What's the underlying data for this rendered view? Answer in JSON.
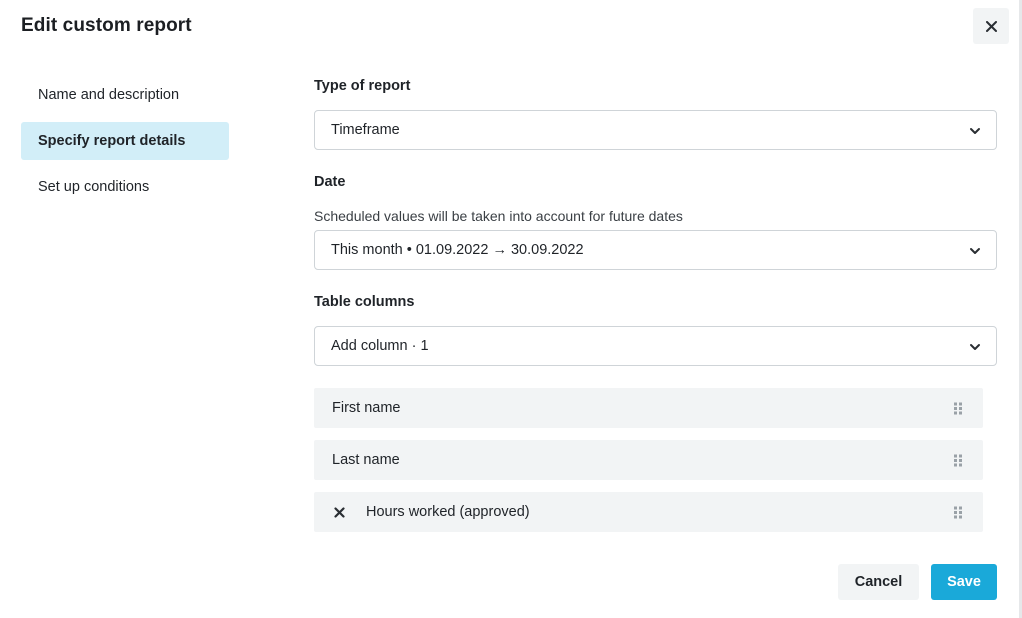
{
  "dialog": {
    "title": "Edit custom report"
  },
  "nav": {
    "items": [
      {
        "label": "Name and description",
        "active": false
      },
      {
        "label": "Specify report details",
        "active": true
      },
      {
        "label": "Set up conditions",
        "active": false
      }
    ]
  },
  "form": {
    "report_type": {
      "label": "Type of report",
      "value": "Timeframe"
    },
    "date": {
      "label": "Date",
      "helper": "Scheduled values will be taken into account for future dates",
      "value": "This month • 01.09.2022 → 30.09.2022"
    },
    "table_columns": {
      "label": "Table columns",
      "add_value": "Add column · 1",
      "columns": [
        {
          "label": "First name",
          "removable": false
        },
        {
          "label": "Last name",
          "removable": false
        },
        {
          "label": "Hours worked (approved)",
          "removable": true
        }
      ]
    }
  },
  "footer": {
    "cancel_label": "Cancel",
    "save_label": "Save"
  },
  "colors": {
    "accent": "#1aa9d9",
    "active_nav_bg": "#d2eef8",
    "row_bg": "#f2f4f5"
  },
  "icons": {
    "close": "close-icon",
    "chevron": "chevron-down-icon",
    "drag": "drag-handle-icon",
    "remove": "remove-icon"
  }
}
